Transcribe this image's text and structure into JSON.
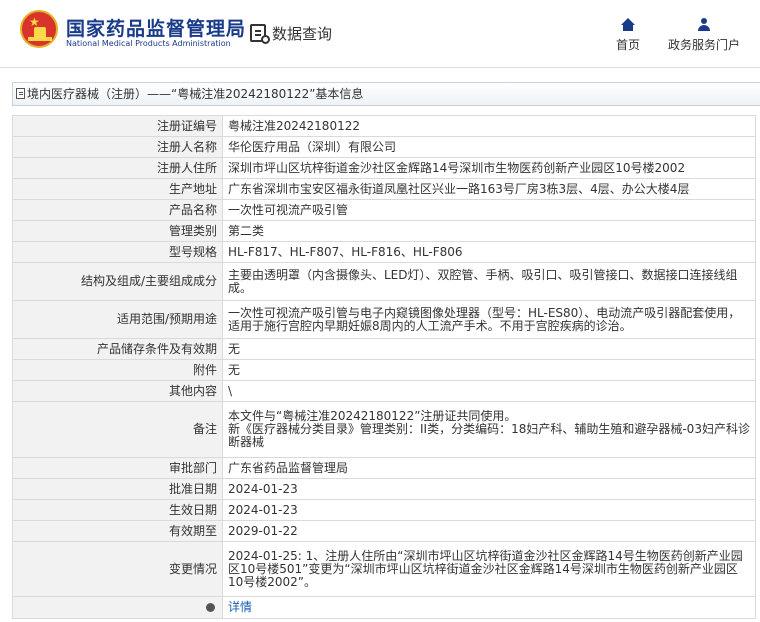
{
  "header": {
    "brand_cn": "国家药品监督管理局",
    "brand_en": "National Medical Products Administration",
    "query_label": "数据查询",
    "nav": [
      {
        "label": "首页",
        "icon": "home-icon"
      },
      {
        "label": "政务服务门户",
        "icon": "user-icon"
      }
    ]
  },
  "breadcrumb": {
    "text": "境内医疗器械（注册）——“粤械注准20242180122”基本信息"
  },
  "rows": [
    {
      "label": "注册证编号",
      "value": "粤械注准20242180122"
    },
    {
      "label": "注册人名称",
      "value": "华伦医疗用品（深圳）有限公司"
    },
    {
      "label": "注册人住所",
      "value": "深圳市坪山区坑梓街道金沙社区金辉路14号深圳市生物医药创新产业园区10号楼2002"
    },
    {
      "label": "生产地址",
      "value": "广东省深圳市宝安区福永街道凤凰社区兴业一路163号厂房3栋3层、4层、办公大楼4层"
    },
    {
      "label": "产品名称",
      "value": "一次性可视流产吸引管"
    },
    {
      "label": "管理类别",
      "value": "第二类"
    },
    {
      "label": "型号规格",
      "value": "HL-F817、HL-F807、HL-F816、HL-F806"
    },
    {
      "label": "结构及组成/主要组成成分",
      "value": "主要由透明罩（内含摄像头、LED灯）、双腔管、手柄、吸引口、吸引管接口、数据接口连接线组成。"
    },
    {
      "label": "适用范围/预期用途",
      "value": "一次性可视流产吸引管与电子内窥镜图像处理器（型号：HL-ES80）、电动流产吸引器配套使用，适用于施行宫腔内早期妊娠8周内的人工流产手术。不用于宫腔疾病的诊治。"
    },
    {
      "label": "产品储存条件及有效期",
      "value": "无"
    },
    {
      "label": "附件",
      "value": "无"
    },
    {
      "label": "其他内容",
      "value": "\\"
    },
    {
      "label": "备注",
      "value": "本文件与“粤械注准20242180122”注册证共同使用。\n新《医疗器械分类目录》管理类别：II类，分类编码：18妇产科、辅助生殖和避孕器械-03妇产科诊断器械"
    },
    {
      "label": "审批部门",
      "value": "广东省药品监督管理局"
    },
    {
      "label": "批准日期",
      "value": "2024-01-23"
    },
    {
      "label": "生效日期",
      "value": "2024-01-23"
    },
    {
      "label": "有效期至",
      "value": "2029-01-22"
    },
    {
      "label": "变更情况",
      "value": "2024-01-25: 1、注册人住所由“深圳市坪山区坑梓街道金沙社区金辉路14号生物医药创新产业园区10号楼501”变更为“深圳市坪山区坑梓街道金沙社区金辉路14号深圳市生物医药创新产业园区10号楼2002”。"
    }
  ],
  "footer_row": {
    "icon": "globe-icon",
    "link_text": "详情"
  }
}
